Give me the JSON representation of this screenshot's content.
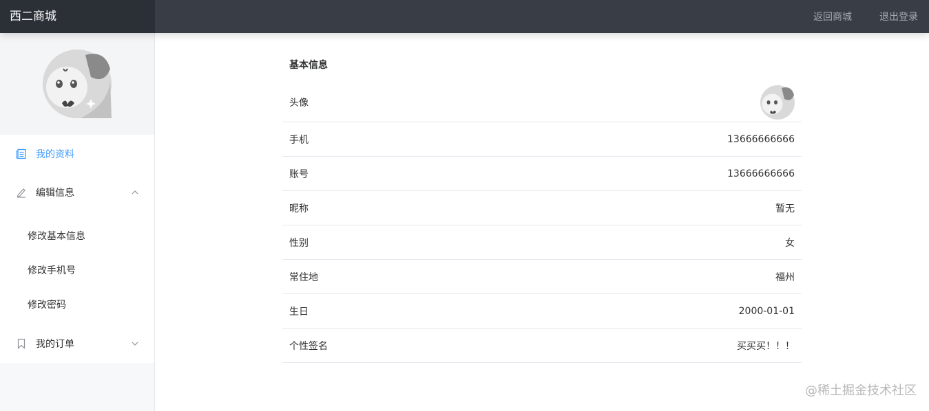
{
  "header": {
    "brand": "西二商城",
    "links": [
      "返回商城",
      "退出登录"
    ]
  },
  "sidebar": {
    "avatar_icon": "cartoon-avatar",
    "items": [
      {
        "label": "我的资料",
        "icon": "document-icon",
        "active": true
      },
      {
        "label": "编辑信息",
        "icon": "edit-icon",
        "expanded": true,
        "children": [
          "修改基本信息",
          "修改手机号",
          "修改密码"
        ]
      },
      {
        "label": "我的订单",
        "icon": "bookmark-icon",
        "expanded": false
      }
    ]
  },
  "profile": {
    "title": "基本信息",
    "rows": [
      {
        "label": "头像",
        "value": ""
      },
      {
        "label": "手机",
        "value": "13666666666"
      },
      {
        "label": "账号",
        "value": "13666666666"
      },
      {
        "label": "昵称",
        "value": "暂无"
      },
      {
        "label": "性别",
        "value": "女"
      },
      {
        "label": "常住地",
        "value": "福州"
      },
      {
        "label": "生日",
        "value": "2000-01-01"
      },
      {
        "label": "个性签名",
        "value": "买买买！！！"
      }
    ]
  },
  "watermark": "@稀土掘金技术社区",
  "colors": {
    "accent": "#409eff",
    "topbar": "#393d46",
    "brand_bg": "#2b2f36"
  }
}
